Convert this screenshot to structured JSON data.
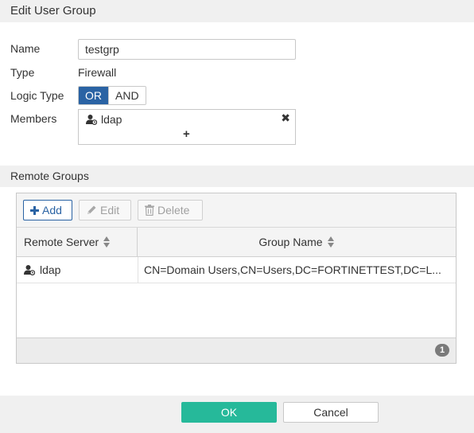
{
  "dialog": {
    "title": "Edit User Group"
  },
  "form": {
    "name_label": "Name",
    "name_value": "testgrp",
    "type_label": "Type",
    "type_value": "Firewall",
    "logic_label": "Logic Type",
    "logic_options": [
      "OR",
      "AND"
    ],
    "logic_selected": "OR",
    "members_label": "Members",
    "members": [
      {
        "name": "ldap",
        "icon": "remote-user-icon"
      }
    ],
    "members_add": "+"
  },
  "remote_groups": {
    "section_title": "Remote Groups",
    "toolbar": {
      "add_label": "Add",
      "edit_label": "Edit",
      "delete_label": "Delete"
    },
    "columns": [
      "Remote Server",
      "Group Name"
    ],
    "rows": [
      {
        "remote_server": "ldap",
        "group_name": "CN=Domain Users,CN=Users,DC=FORTINETTEST,DC=L..."
      }
    ],
    "count": "1"
  },
  "buttons": {
    "ok_label": "OK",
    "cancel_label": "Cancel"
  },
  "colors": {
    "accent": "#2a63a4",
    "ok": "#26b99a",
    "bar": "#f0f0f0"
  }
}
